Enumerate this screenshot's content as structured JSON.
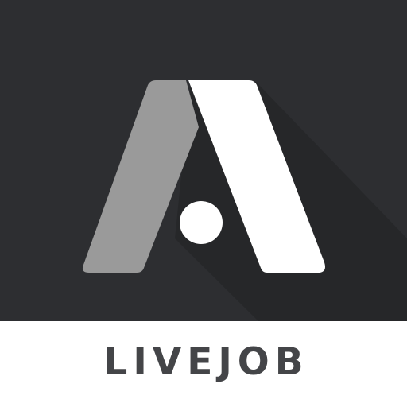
{
  "app": {
    "name": "LIVEJOB"
  },
  "logo": {
    "icon": "letter-a-logo-icon",
    "colors": {
      "background": "#2d2e31",
      "left_stroke": "#9a9a9a",
      "right_stroke": "#ffffff",
      "dot": "#ffffff",
      "shadow": "#262729",
      "wordmark": "#444548",
      "band": "#ffffff"
    }
  }
}
